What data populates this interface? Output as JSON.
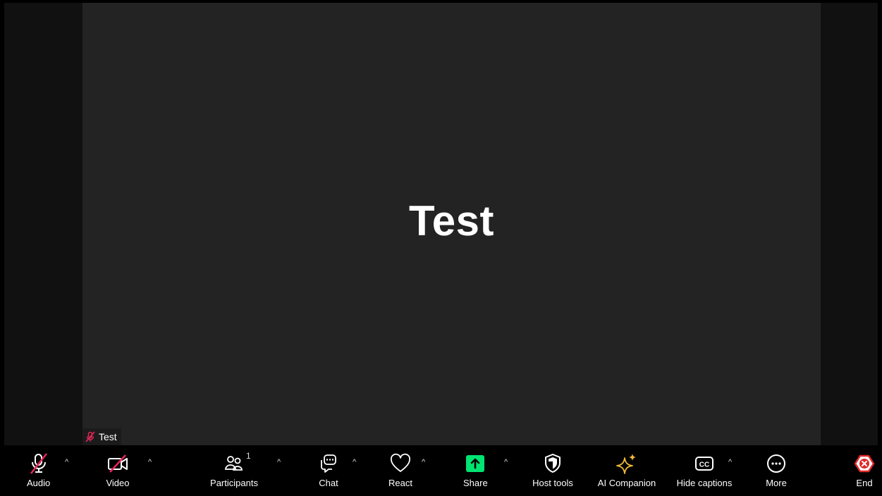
{
  "video": {
    "tile_name": "Test",
    "name_tag": "Test"
  },
  "toolbar": {
    "audio": "Audio",
    "video": "Video",
    "participants": "Participants",
    "participants_count": "1",
    "chat": "Chat",
    "react": "React",
    "share": "Share",
    "host_tools": "Host tools",
    "ai_companion": "AI Companion",
    "hide_captions": "Hide captions",
    "more": "More",
    "end": "End",
    "caret": "^"
  },
  "colors": {
    "muted_red": "#e8275a",
    "share_green": "#00e472",
    "ai_gold": "#f0b93a",
    "end_red": "#e02828"
  }
}
